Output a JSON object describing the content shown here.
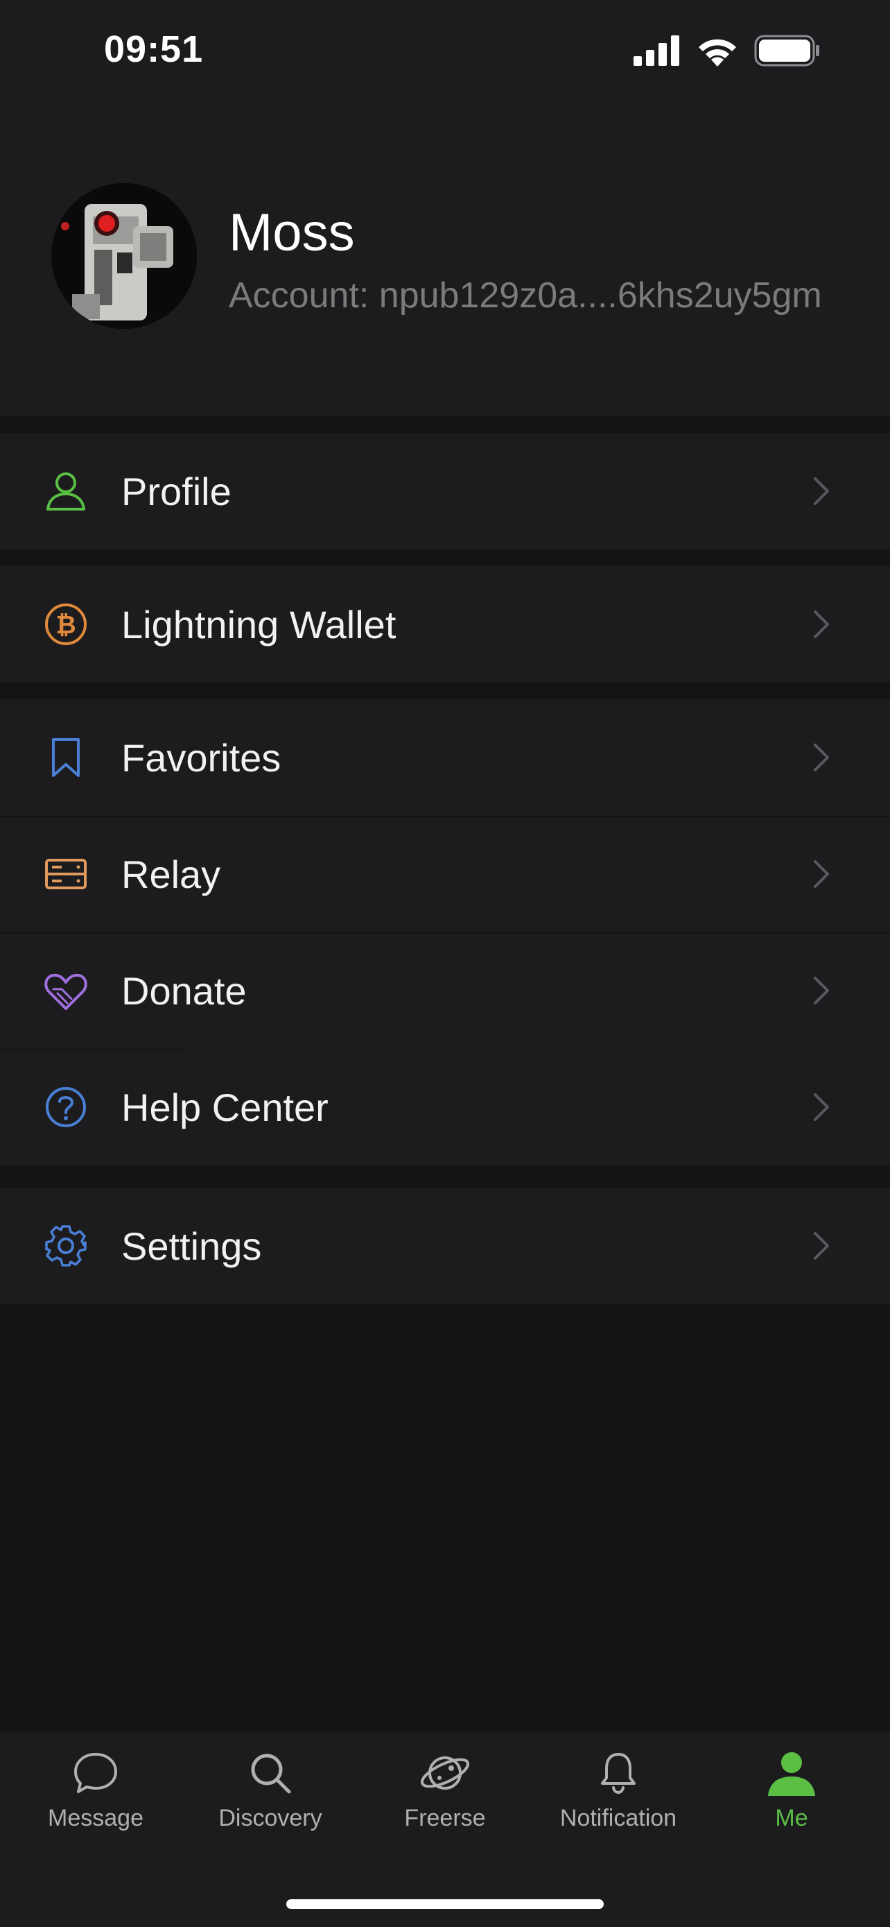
{
  "status_bar": {
    "time": "09:51"
  },
  "profile": {
    "name": "Moss",
    "account": "Account: npub129z0a....6khs2uy5gm"
  },
  "menu": {
    "profile": "Profile",
    "lightning_wallet": "Lightning Wallet",
    "favorites": "Favorites",
    "relay": "Relay",
    "donate": "Donate",
    "help_center": "Help Center",
    "settings": "Settings"
  },
  "tabs": {
    "message": "Message",
    "discovery": "Discovery",
    "freerse": "Freerse",
    "notification": "Notification",
    "me": "Me"
  },
  "colors": {
    "accent_green": "#5bbf44",
    "bitcoin_orange": "#e08a3c",
    "favorites_blue": "#4a7fd6",
    "relay_orange": "#e09a5e",
    "donate_purple": "#a070e0",
    "help_blue": "#4a7fd6",
    "settings_blue": "#4a7fd6"
  }
}
